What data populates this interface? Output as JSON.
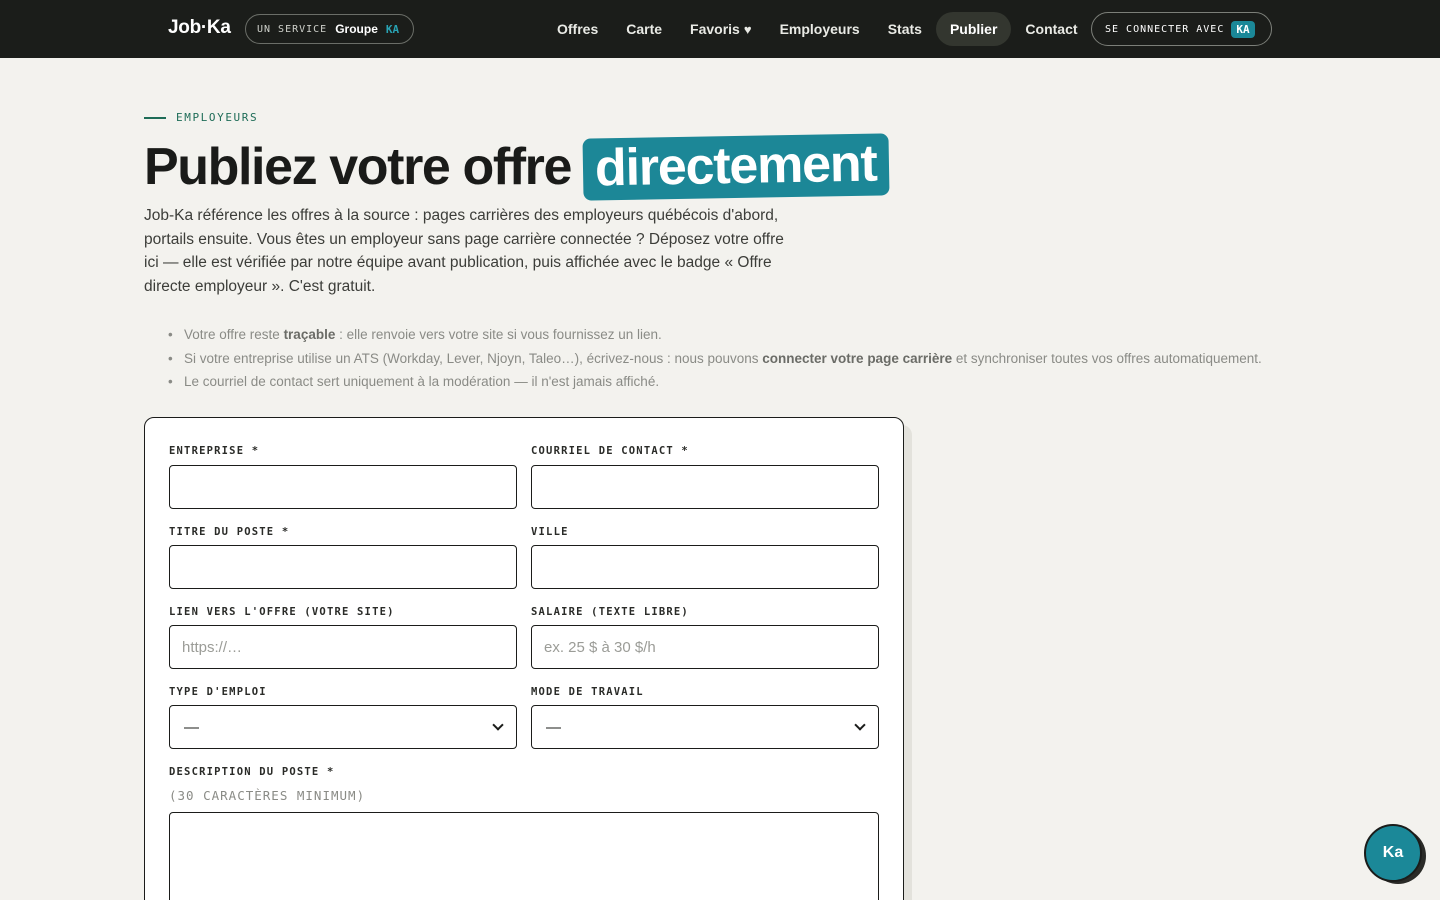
{
  "nav": {
    "logo": "Job·Ka",
    "service": {
      "prefix": "UN SERVICE",
      "group": "Groupe",
      "ka": "KA"
    },
    "menu": [
      {
        "label": "Offres"
      },
      {
        "label": "Carte"
      },
      {
        "label": "Favoris",
        "icon": "heart-icon"
      },
      {
        "label": "Employeurs"
      },
      {
        "label": "Stats"
      },
      {
        "label": "Publier",
        "active": true
      },
      {
        "label": "Contact"
      }
    ],
    "login": {
      "label": "SE CONNECTER AVEC",
      "badge": "KA"
    }
  },
  "hero": {
    "eyebrow": "EMPLOYEURS",
    "title_plain": "Publiez votre offre",
    "title_highlight": "directement",
    "intro": "Job-Ka référence les offres à la source : pages carrières des employeurs québécois d'abord, portails ensuite. Vous êtes un employeur sans page carrière connectée ? Déposez votre offre ici — elle est vérifiée par notre équipe avant publication, puis affichée avec le badge « Offre directe employeur ». C'est gratuit."
  },
  "bullets": [
    {
      "before": "Votre offre reste ",
      "bold": "traçable",
      "after": " : elle renvoie vers votre site si vous fournissez un lien."
    },
    {
      "before": "Si votre entreprise utilise un ATS (Workday, Lever, Njoyn, Taleo…), écrivez-nous : nous pouvons ",
      "bold": "connecter votre page carrière",
      "after": " et synchroniser toutes vos offres automatiquement."
    },
    {
      "before": "Le courriel de contact sert uniquement à la modération — il n'est jamais affiché.",
      "bold": "",
      "after": ""
    }
  ],
  "form": {
    "company_label": "ENTREPRISE *",
    "email_label": "COURRIEL DE CONTACT *",
    "title_label": "TITRE DU POSTE *",
    "city_label": "VILLE",
    "link_label": "LIEN VERS L'OFFRE (VOTRE SITE)",
    "link_placeholder": "https://…",
    "salary_label": "SALAIRE (TEXTE LIBRE)",
    "salary_placeholder": "ex. 25 $ à 30 $/h",
    "type_label": "TYPE D'EMPLOI",
    "type_value": "—",
    "mode_label": "MODE DE TRAVAIL",
    "mode_value": "—",
    "desc_label": "DESCRIPTION DU POSTE *",
    "desc_hint": "(30 CARACTÈRES MINIMUM)"
  },
  "fab": {
    "label": "Ka"
  }
}
